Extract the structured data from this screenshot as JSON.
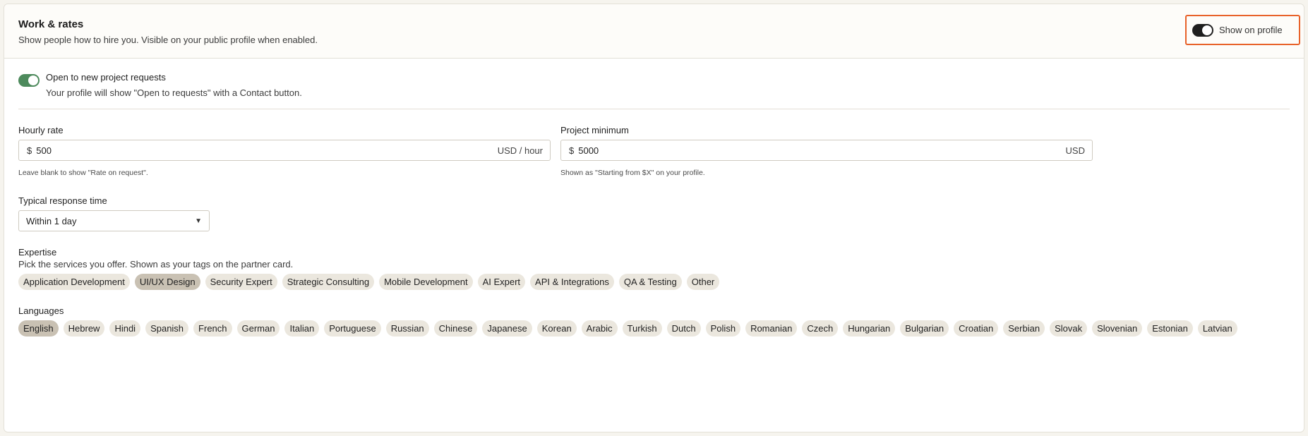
{
  "header": {
    "title": "Work & rates",
    "subtitle": "Show people how to hire you. Visible on your public profile when enabled.",
    "show_on_profile_label": "Show on profile"
  },
  "open_requests": {
    "title": "Open to new project requests",
    "description": "Your profile will show \"Open to requests\" with a Contact button.",
    "enabled": true
  },
  "hourly_rate": {
    "label": "Hourly rate",
    "currency_symbol": "$",
    "value": "500",
    "unit": "USD / hour",
    "help": "Leave blank to show \"Rate on request\"."
  },
  "project_minimum": {
    "label": "Project minimum",
    "currency_symbol": "$",
    "value": "5000",
    "unit": "USD",
    "help": "Shown as \"Starting from $X\" on your profile."
  },
  "response_time": {
    "label": "Typical response time",
    "selected": "Within 1 day"
  },
  "expertise": {
    "label": "Expertise",
    "description": "Pick the services you offer. Shown as your tags on the partner card.",
    "options": [
      "Application Development",
      "UI/UX Design",
      "Security Expert",
      "Strategic Consulting",
      "Mobile Development",
      "AI Expert",
      "API & Integrations",
      "QA & Testing",
      "Other"
    ],
    "selected": [
      "UI/UX Design"
    ]
  },
  "languages": {
    "label": "Languages",
    "options": [
      "English",
      "Hebrew",
      "Hindi",
      "Spanish",
      "French",
      "German",
      "Italian",
      "Portuguese",
      "Russian",
      "Chinese",
      "Japanese",
      "Korean",
      "Arabic",
      "Turkish",
      "Dutch",
      "Polish",
      "Romanian",
      "Czech",
      "Hungarian",
      "Bulgarian",
      "Croatian",
      "Serbian",
      "Slovak",
      "Slovenian",
      "Estonian",
      "Latvian"
    ],
    "selected": [
      "English"
    ]
  },
  "colors": {
    "accent_highlight": "#e8622a",
    "toggle_on_green": "#4d8a5c",
    "toggle_on_dark": "#1f1f1f",
    "chip_bg": "#ebe7de",
    "chip_selected_bg": "#c9c1b3"
  }
}
